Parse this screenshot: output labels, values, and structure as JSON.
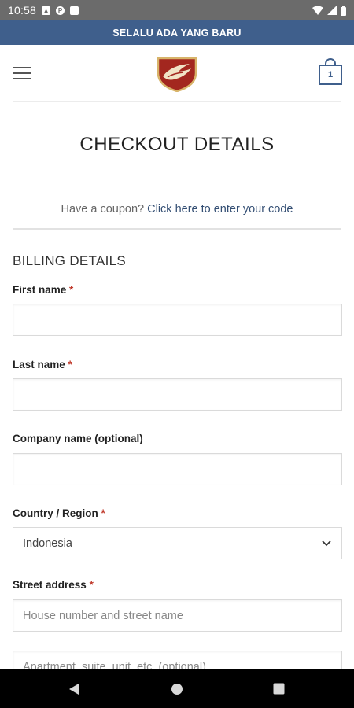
{
  "status_bar": {
    "time": "10:58"
  },
  "announcement": "SELALU ADA YANG BARU",
  "header": {
    "cart_count": "1"
  },
  "page_title": "CHECKOUT DETAILS",
  "coupon": {
    "prompt": "Have a coupon?",
    "link": "Click here to enter your code"
  },
  "billing": {
    "title": "BILLING DETAILS",
    "required_marker": "*",
    "first_name": {
      "label": "First name",
      "value": ""
    },
    "last_name": {
      "label": "Last name",
      "value": ""
    },
    "company": {
      "label": "Company name (optional)",
      "value": ""
    },
    "country": {
      "label": "Country / Region",
      "value": "Indonesia"
    },
    "street": {
      "label": "Street address",
      "placeholder": "House number and street name",
      "placeholder2": "Apartment, suite, unit, etc. (optional)"
    }
  },
  "colors": {
    "accent": "#3f5f8c",
    "required": "#c0392b",
    "logo": "#a3271f"
  }
}
